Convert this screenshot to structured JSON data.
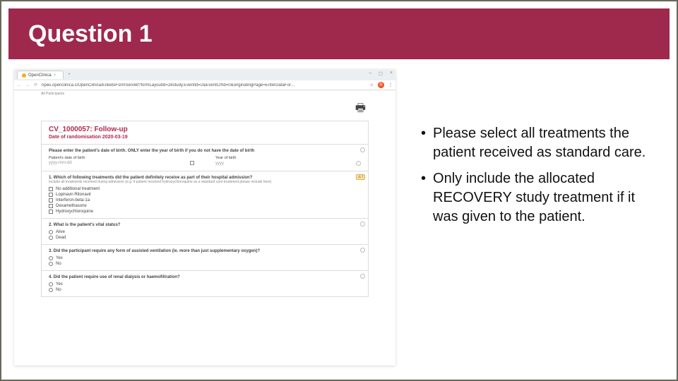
{
  "slide": {
    "title": "Question 1",
    "bullets": [
      "Please select all treatments the patient received as standard care.",
      "Only include the allocated RECOVERY study treatment if it was given to the patient."
    ]
  },
  "browser": {
    "tab_title": "OpenClinica",
    "window_controls": [
      "–",
      "◻",
      "×"
    ],
    "url": "npeu.openclinica.c/OpenClinica/EnketoFormServlet?formLayoutId=28study.EventId=2&EventCrfId=0&originatingPage=EnterDataFor…",
    "star_icon": "☆",
    "menu_icon": "⋮",
    "avatar_letter": "R"
  },
  "form": {
    "breadcrumbs": "All Participants",
    "heading": "CV_1000057: Follow-up",
    "subheading": "Date of randomisation 2020-03-19",
    "dob_block": {
      "instruction": "Please enter the patient's date of birth. ONLY enter the year of birth if you do not have the date of birth",
      "patient_dob_label": "Patient's date of birth",
      "patient_dob_placeholder": "yyyy-mm-dd",
      "year_label": "Year of birth",
      "year_placeholder": "yyyy"
    },
    "q1": {
      "text": "1. Which of following treatments did the patient definitely receive as part of their hospital admission?",
      "hint": "Include all treatments received during admission (e.g. if patient received hydroxychloroquine as a standard care treatment please include here)",
      "warn": "⚠ !",
      "options": [
        "No additional treatment",
        "Lopinavir-Ritonavir",
        "Interferon-beta-1a",
        "Dexamethasone",
        "Hydroxychloroquine"
      ]
    },
    "q2": {
      "text": "2. What is the patient's vital status?",
      "options": [
        "Alive",
        "Dead"
      ]
    },
    "q3": {
      "text": "3. Did the participant require any form of assisted ventilation (ie. more than just supplementary oxygen)?",
      "options": [
        "Yes",
        "No"
      ]
    },
    "q4": {
      "text": "4. Did the patient require use of renal dialysis or haemofiltration?",
      "options": [
        "Yes",
        "No"
      ]
    }
  }
}
